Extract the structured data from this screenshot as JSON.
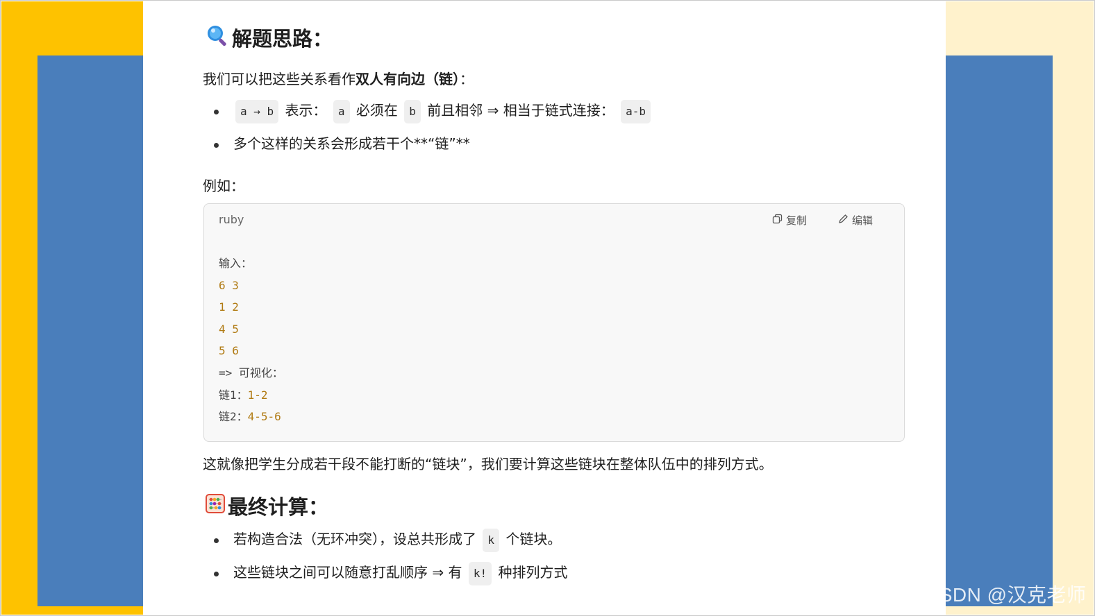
{
  "section1": {
    "icon": "magnifier-icon",
    "title": "解题思路：",
    "intro_prefix": "我们可以把这些关系看作",
    "intro_bold": "双人有向边（链）",
    "intro_suffix": "：",
    "bullets": [
      {
        "code1": "a → b",
        "t1": "表示：",
        "code2": "a",
        "t2": "必须在",
        "code3": "b",
        "t3": "前且相邻 ⇒ 相当于链式连接：",
        "code4": "a-b"
      },
      {
        "text": "多个这样的关系会形成若干个**“链”**"
      }
    ],
    "example_label": "例如："
  },
  "code_block": {
    "language": "ruby",
    "copy_label": "复制",
    "edit_label": "编辑",
    "lines": {
      "l1": "输入：",
      "l2": "6 3",
      "l3": "1 2",
      "l4": "4 5",
      "l5": "5 6",
      "l6": "=> 可视化：",
      "l7_label": "链1：",
      "l7_value": "1-2",
      "l8_label": "链2：",
      "l8_value": "4-5-6"
    }
  },
  "explanation": "这就像把学生分成若干段不能打断的“链块”，我们要计算这些链块在整体队伍中的排列方式。",
  "section2": {
    "icon": "abacus-icon",
    "title": "最终计算：",
    "bullets": [
      {
        "t1": "若构造合法（无环冲突），设总共形成了",
        "code": "k",
        "t2": "个链块。"
      },
      {
        "t1": "这些链块之间可以随意打乱顺序 ⇒ 有",
        "code": "k!",
        "t2": "种排列方式"
      }
    ]
  },
  "watermark": "CSDN @汉克老师",
  "colors": {
    "yellow": "#fec200",
    "blue": "#4a7ebb",
    "cream": "#fff2cc",
    "code_number": "#b07a12"
  }
}
